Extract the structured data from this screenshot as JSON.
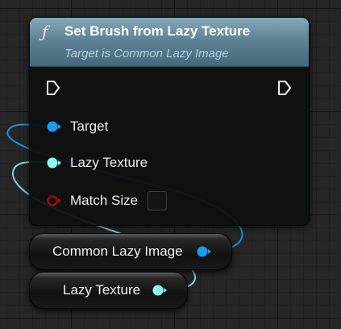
{
  "function_node": {
    "icon": "function-icon",
    "title": "Set Brush from Lazy Texture",
    "subtitle": "Target is Common Lazy Image",
    "exec_in_icon": "exec-pin-icon",
    "exec_out_icon": "exec-pin-icon",
    "pins": [
      {
        "label": "Target",
        "color": "#1a9cef"
      },
      {
        "label": "Lazy Texture",
        "color": "#8ff6f2"
      },
      {
        "label": "Match Size",
        "color": "#9c0f0f"
      }
    ],
    "match_size_checked": false
  },
  "variable_nodes": [
    {
      "label": "Common Lazy Image",
      "pin_color": "#1a9cef"
    },
    {
      "label": "Lazy Texture",
      "pin_color": "#8ff6f2"
    }
  ],
  "colors": {
    "header_top": "#86a9ba",
    "header_bottom": "#45687a",
    "wire_object": "#1a9cef",
    "wire_texture": "#8ff6f2",
    "graph_background": "#262626"
  }
}
